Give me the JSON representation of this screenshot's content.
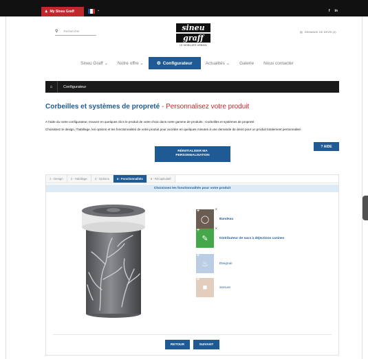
{
  "topbar": {
    "account_label": "My Sineu Graff",
    "flag_caret": "⌄",
    "social": [
      "f",
      "in"
    ],
    "colors": {
      "bar": "#111111",
      "account": "#c0282d"
    }
  },
  "header": {
    "search_placeholder": "Rechercher",
    "logo_line1": "sineu",
    "logo_line2": "graff",
    "logo_tagline": "LE MOBILIER URBAIN",
    "devis_label": "DEMANDE DE DEVIS (0)"
  },
  "nav": {
    "items": [
      "Sineu Graff ⌄",
      "Notre offre ⌄",
      "Configurateur",
      "Actualités ⌄",
      "Galerie",
      "Nous contacter"
    ],
    "active_index": 2,
    "accent": "#1f5a95"
  },
  "breadcrumb": {
    "label": "Configurateur"
  },
  "page": {
    "title_bold": "Corbeilles et systèmes de propreté",
    "title_rest": " - Personnalisez votre produit",
    "intro_1": "A l'aide du notre configurateur, trouvez en quelques clics le produit de votre choix dans notre gamme de produits : Corbeilles et systèmes de propreté.",
    "intro_2": "Choisissez le design, l'habillage, les options et les fonctionnalités de votre produit pour accéder en quelques minutes à une demande de devis pour un produit totalement personnalisé.",
    "reset_line1": "RÉINITIALISER MA",
    "reset_line2": "PERSONNALISATION",
    "aide_label": "? AIDE"
  },
  "configurator": {
    "tabs": [
      "1 - Design",
      "2 - Habillage",
      "3 - Options",
      "4 - Fonctionnalités",
      "5 - Récapitulatif"
    ],
    "active_tab": 3,
    "subheading": "Choisissez les fonctionnalités pour votre produit",
    "features": [
      {
        "label": "Bandeau",
        "icon": "bandeau-icon",
        "color": "#6b5d52",
        "selected": true
      },
      {
        "label": "Distributeur de sacs à déjections canines",
        "icon": "dog-bag-dispenser-icon",
        "color": "#44a84a",
        "selected": true
      },
      {
        "label": "Éteignoir",
        "icon": "ashtray-icon",
        "color": "#b9cde4",
        "selected": false
      },
      {
        "label": "Serrure",
        "icon": "lock-icon",
        "color": "#e3cdbd",
        "selected": false
      }
    ],
    "back_label": "RETOUR",
    "next_label": "SUIVANT"
  }
}
